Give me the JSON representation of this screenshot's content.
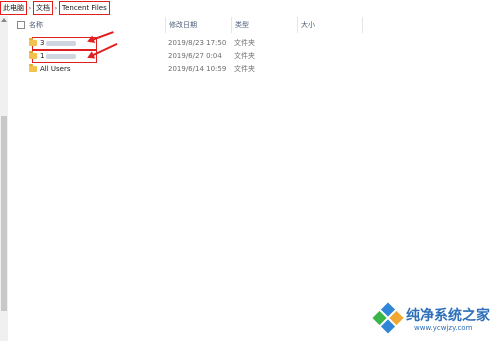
{
  "breadcrumb": {
    "items": [
      {
        "label": "此电脑"
      },
      {
        "label": "文档"
      },
      {
        "label": "Tencent Files"
      }
    ],
    "separator": "›"
  },
  "columns": {
    "name": "名称",
    "date": "修改日期",
    "type": "类型",
    "size": "大小"
  },
  "rows": [
    {
      "name": "3",
      "date": "2019/8/23 17:50",
      "type": "文件夹"
    },
    {
      "name": "1",
      "date": "2019/6/27 0:04",
      "type": "文件夹"
    },
    {
      "name": "All Users",
      "date": "2019/6/14 10:59",
      "type": "文件夹"
    }
  ],
  "watermark": {
    "title": "纯净系统之家",
    "url": "www.ycwjzy.com"
  },
  "colors": {
    "highlight": "#e02020",
    "folder": "#f2c14e",
    "header_text": "#4d5b78"
  }
}
